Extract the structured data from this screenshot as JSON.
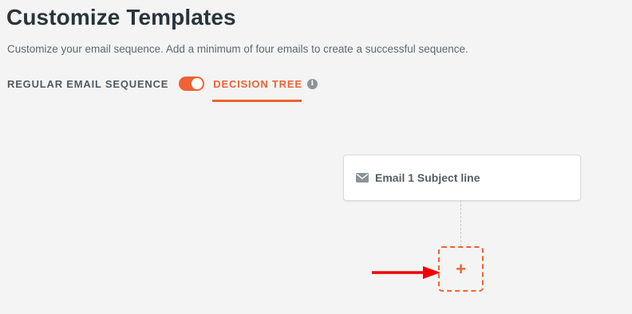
{
  "header": {
    "title": "Customize Templates",
    "subtitle": "Customize your email sequence. Add a minimum of four emails to create a successful sequence."
  },
  "mode_switch": {
    "regular_label": "REGULAR EMAIL SEQUENCE",
    "decision_label": "DECISION TREE",
    "toggle_on": true,
    "info_icon": "info-icon",
    "info_glyph": "i"
  },
  "tree": {
    "email_card": {
      "icon": "mail-icon",
      "subject": "Email 1 Subject line"
    },
    "add_node": {
      "icon": "plus-icon",
      "glyph": "+"
    }
  },
  "annotation": {
    "arrow_icon": "arrow-right-icon",
    "arrow_color": "#f00000"
  },
  "colors": {
    "accent": "#ef6235",
    "background": "#f4f4f4",
    "title": "#28353b",
    "muted": "#5e6a70"
  }
}
